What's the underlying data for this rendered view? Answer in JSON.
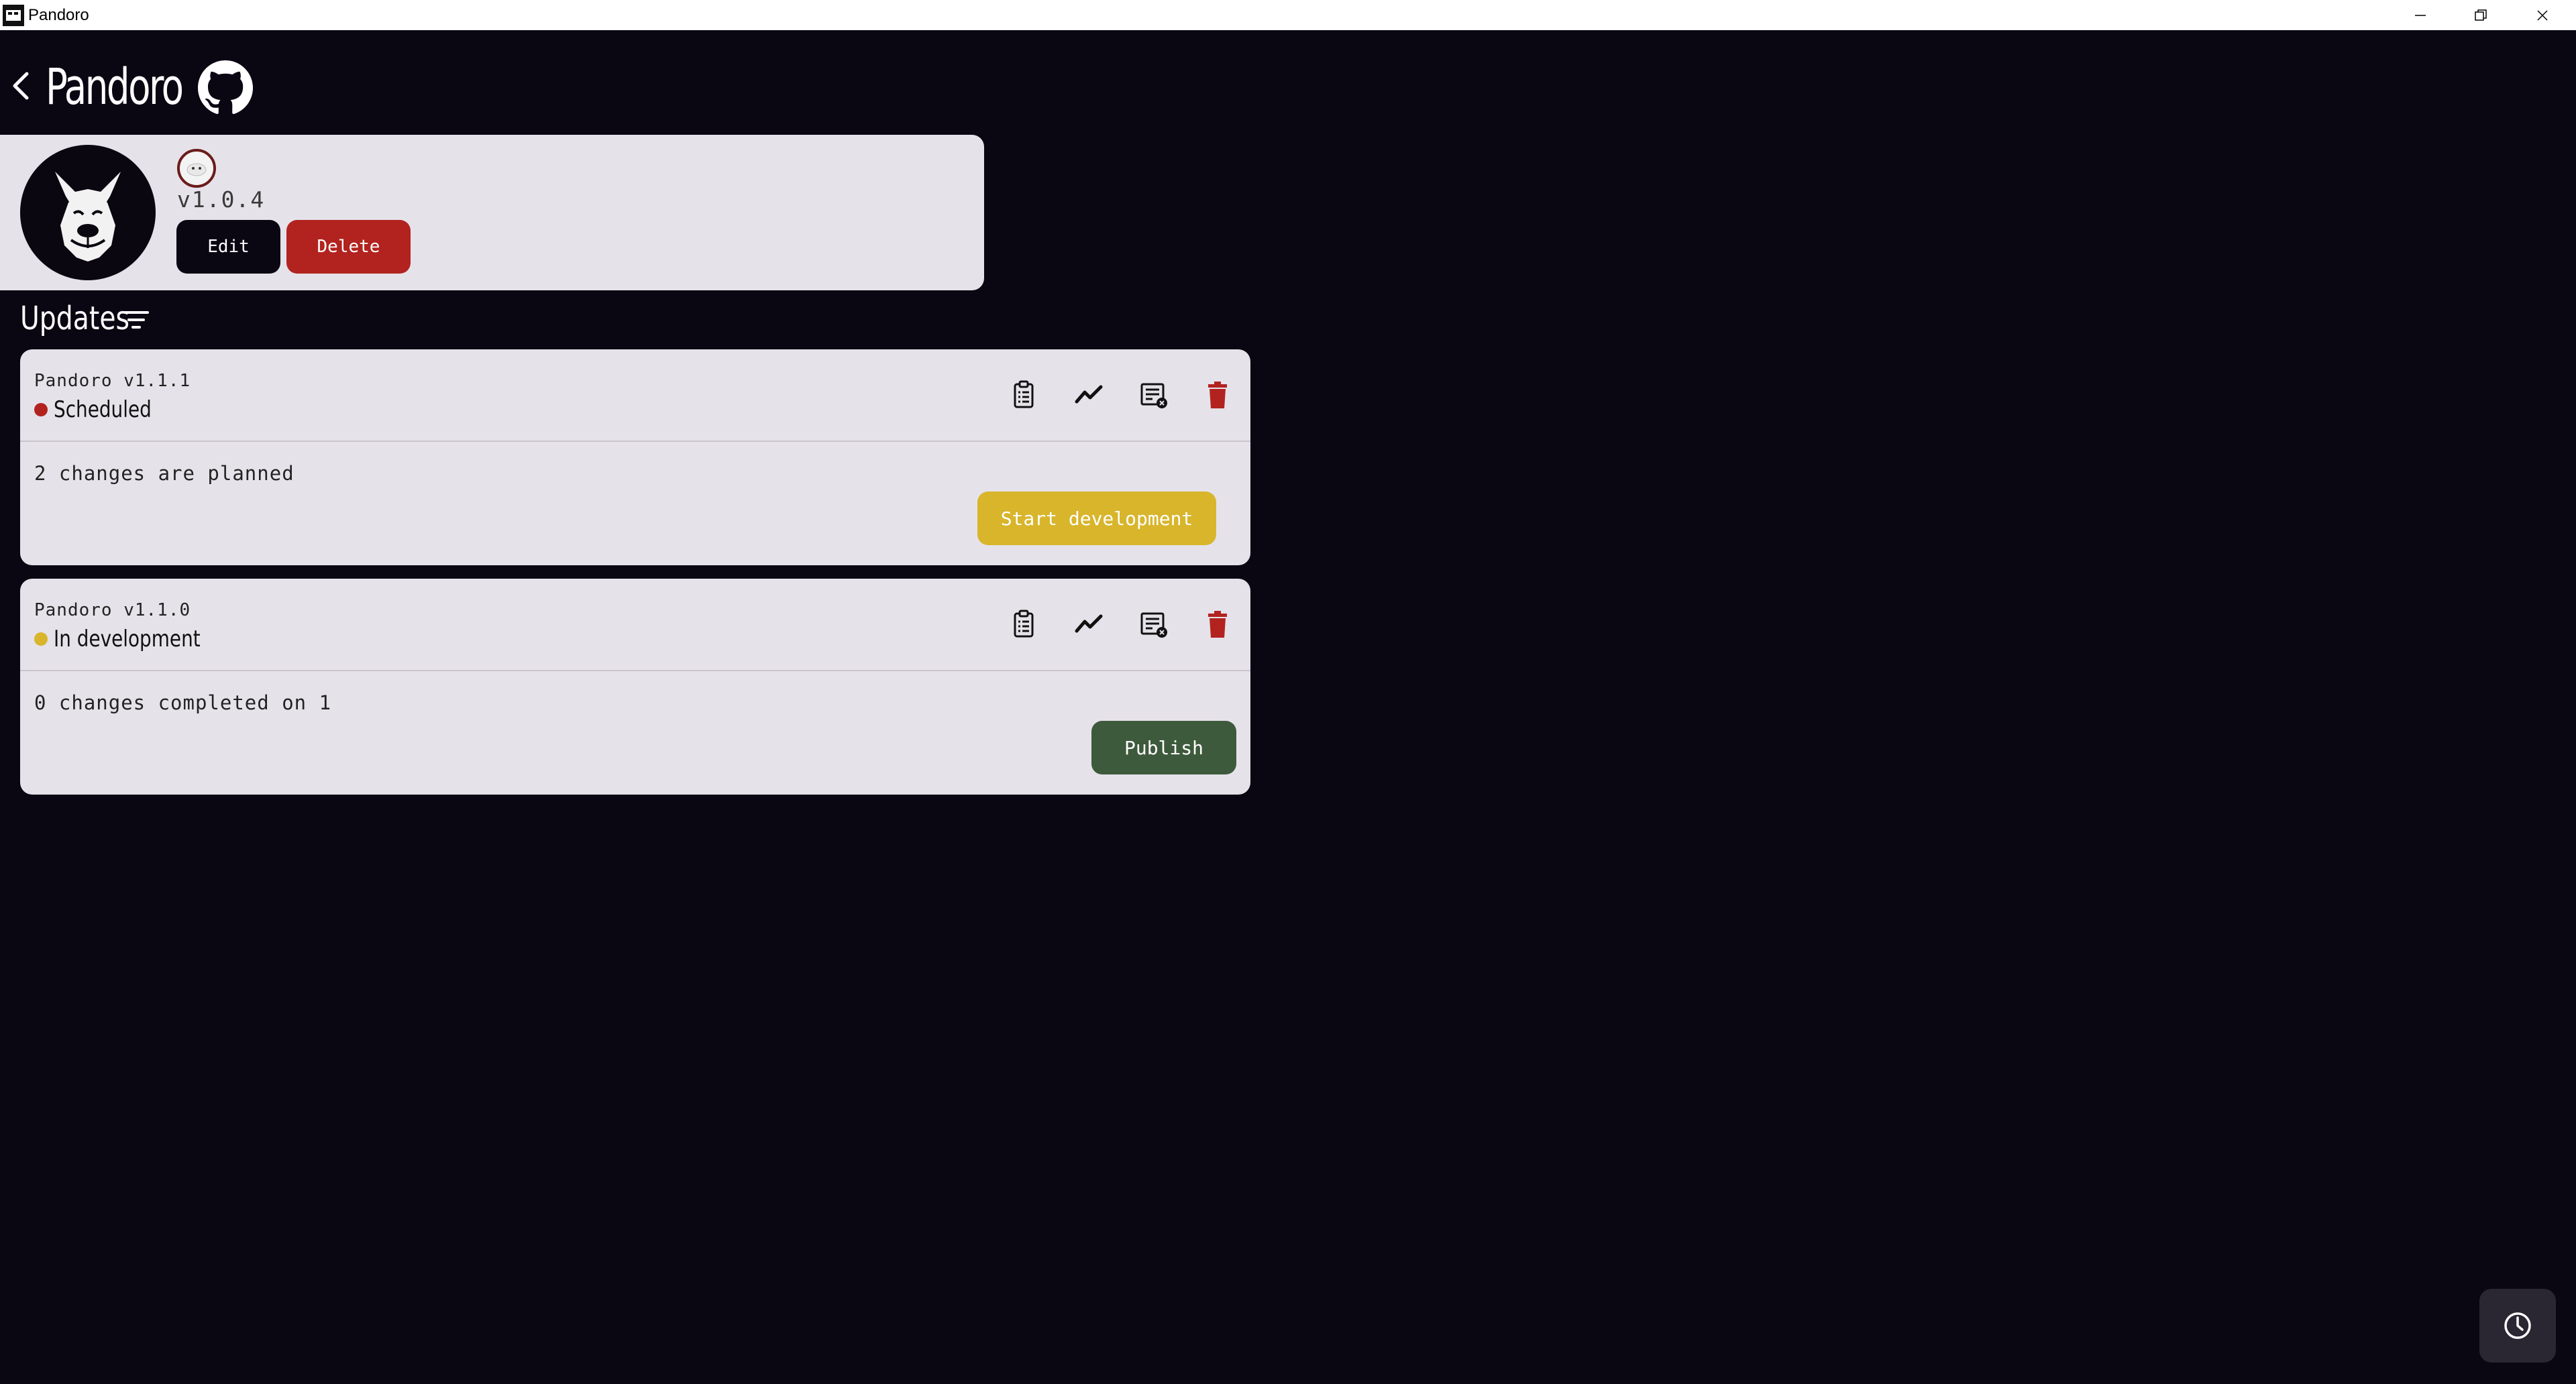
{
  "window": {
    "title": "Pandoro"
  },
  "header": {
    "title": "Pandoro"
  },
  "project": {
    "version": "v1.0.4",
    "edit_label": "Edit",
    "delete_label": "Delete"
  },
  "updates": {
    "title": "Updates",
    "items": [
      {
        "name": "Pandoro v1.1.1",
        "status": "Scheduled",
        "status_color": "#b2231f",
        "summary": "2 changes are planned",
        "action_label": "Start development",
        "action_color": "#d8b52b",
        "action_text_color": "#ffffff"
      },
      {
        "name": "Pandoro v1.1.0",
        "status": "In development",
        "status_color": "#d8b52b",
        "summary": "0 changes completed on 1",
        "action_label": "Publish",
        "action_color": "#3e5a3c",
        "action_text_color": "#ffffff"
      }
    ]
  },
  "colors": {
    "background": "#0a0612",
    "card": "#e6e2ea",
    "danger": "#b2231f",
    "icon_dark": "#111111"
  },
  "icons": {
    "back": "chevron-left-icon",
    "github": "github-icon",
    "filter": "filter-icon",
    "notes": "clipboard-icon",
    "stats": "trend-icon",
    "report": "report-icon",
    "delete": "trash-icon",
    "history": "clock-icon"
  }
}
